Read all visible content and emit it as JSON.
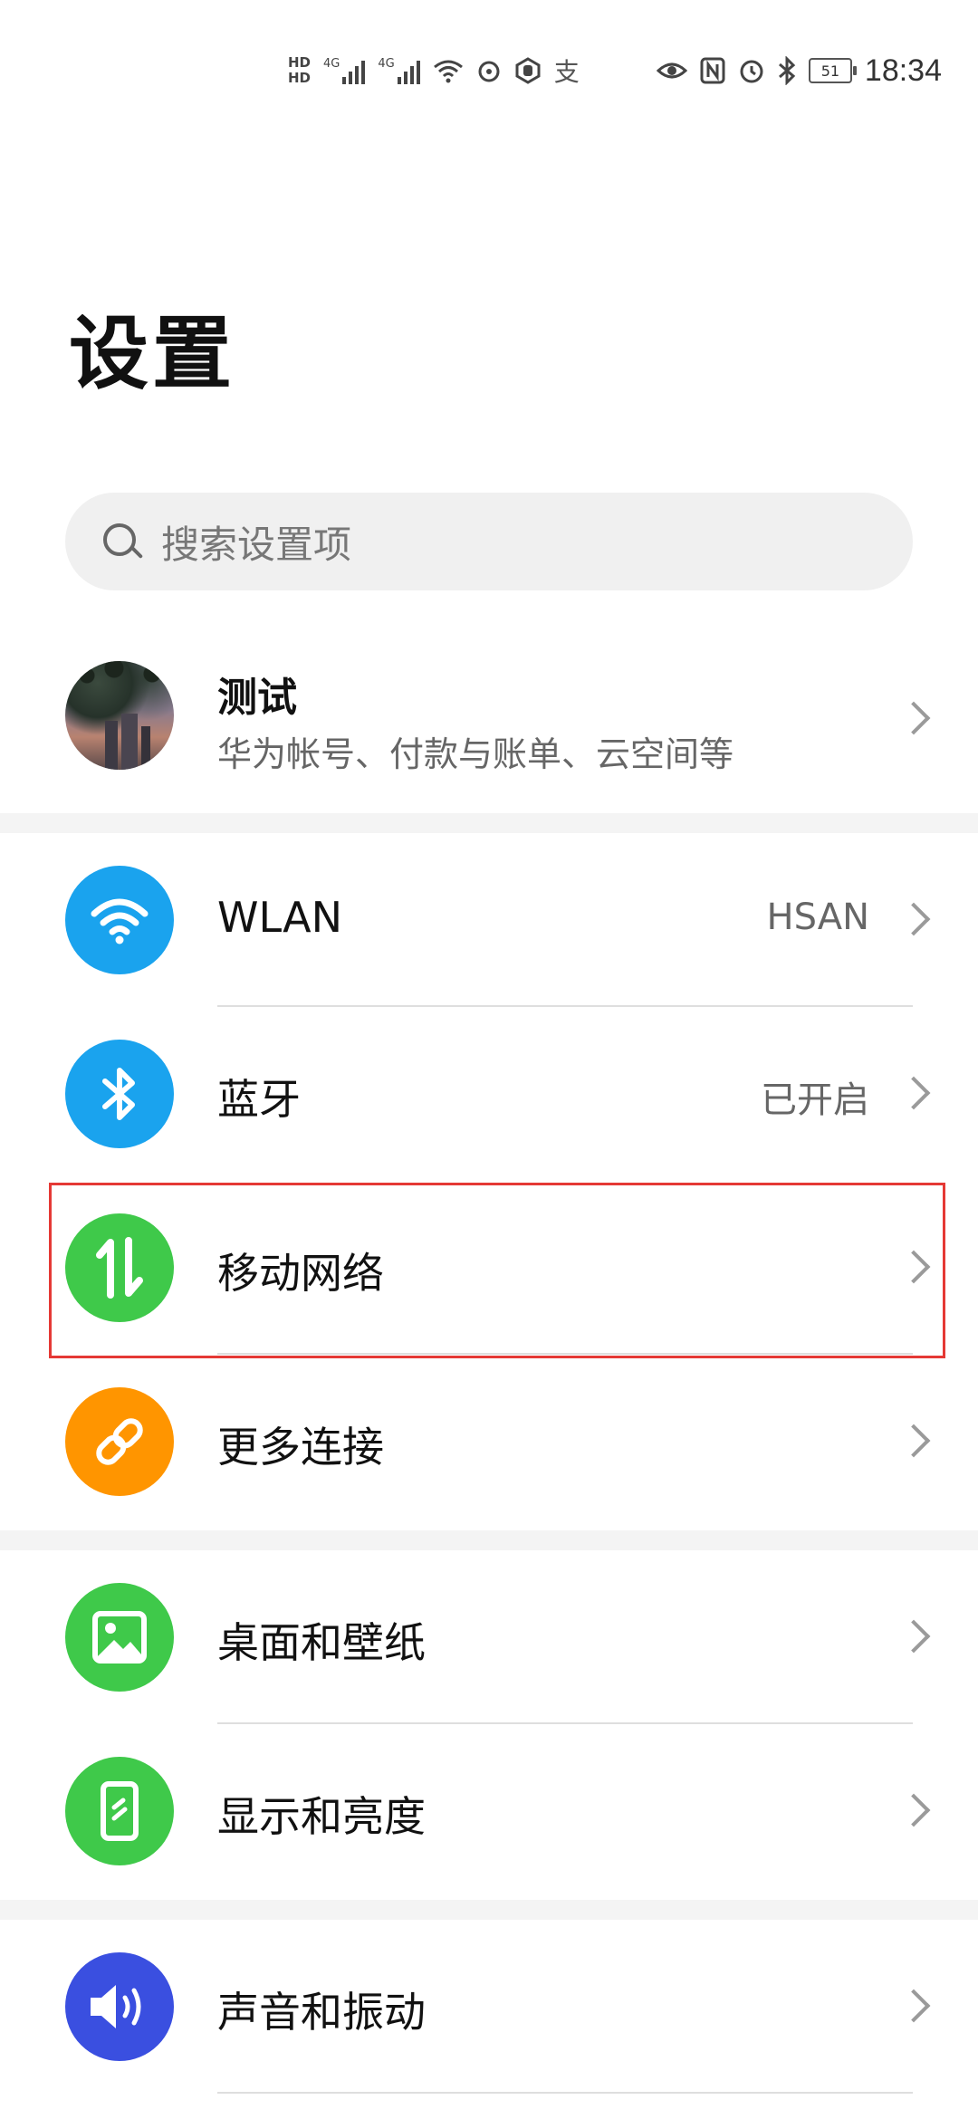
{
  "status_bar": {
    "hd_top": "HD",
    "hd_bottom": "HD",
    "sim1": "4G",
    "sim2": "4G",
    "extra_icons": [
      "wifi-icon",
      "sync-icon",
      "hand-icon",
      "alipay-icon"
    ],
    "alipay_glyph": "支",
    "right_icons": [
      "eye-icon",
      "nfc-icon",
      "alarm-icon",
      "bluetooth-icon"
    ],
    "battery_level": "51",
    "time": "18:34"
  },
  "page": {
    "title": "设置"
  },
  "search": {
    "placeholder": "搜索设置项"
  },
  "account": {
    "name": "测试",
    "subtitle": "华为帐号、付款与账单、云空间等"
  },
  "settings": [
    {
      "label": "WLAN",
      "value": "HSAN",
      "icon": "wifi-icon",
      "color": "#1aa3ee"
    },
    {
      "label": "蓝牙",
      "value": "已开启",
      "icon": "bluetooth-icon",
      "color": "#1aa3ee"
    },
    {
      "label": "移动网络",
      "value": "",
      "icon": "mobile-data-icon",
      "color": "#3fc94a",
      "highlighted": true
    },
    {
      "label": "更多连接",
      "value": "",
      "icon": "link-icon",
      "color": "#ff9500"
    },
    {
      "label": "桌面和壁纸",
      "value": "",
      "icon": "wallpaper-icon",
      "color": "#3fc94a"
    },
    {
      "label": "显示和亮度",
      "value": "",
      "icon": "display-icon",
      "color": "#3fc94a"
    },
    {
      "label": "声音和振动",
      "value": "",
      "icon": "sound-icon",
      "color": "#3a4fe0"
    }
  ]
}
